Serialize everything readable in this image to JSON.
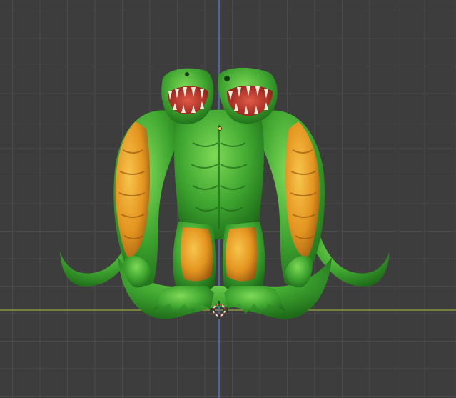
{
  "viewport": {
    "background_color": "#3d3d3d",
    "grid_color": "#4a4a4a",
    "x_axis_color": "#7f8d3a",
    "y_axis_color": "#4f6da5"
  },
  "model": {
    "skin_color": "#3fa630",
    "skin_highlight": "#6fd04a",
    "skin_shadow": "#1f6e1a",
    "armor_color": "#e3941f",
    "armor_highlight": "#f5c04a",
    "mouth_color": "#c8322a",
    "teeth_color": "#f1ebd8"
  },
  "icons": {
    "cursor": "3d-cursor-icon",
    "origin": "object-origin-icon"
  }
}
